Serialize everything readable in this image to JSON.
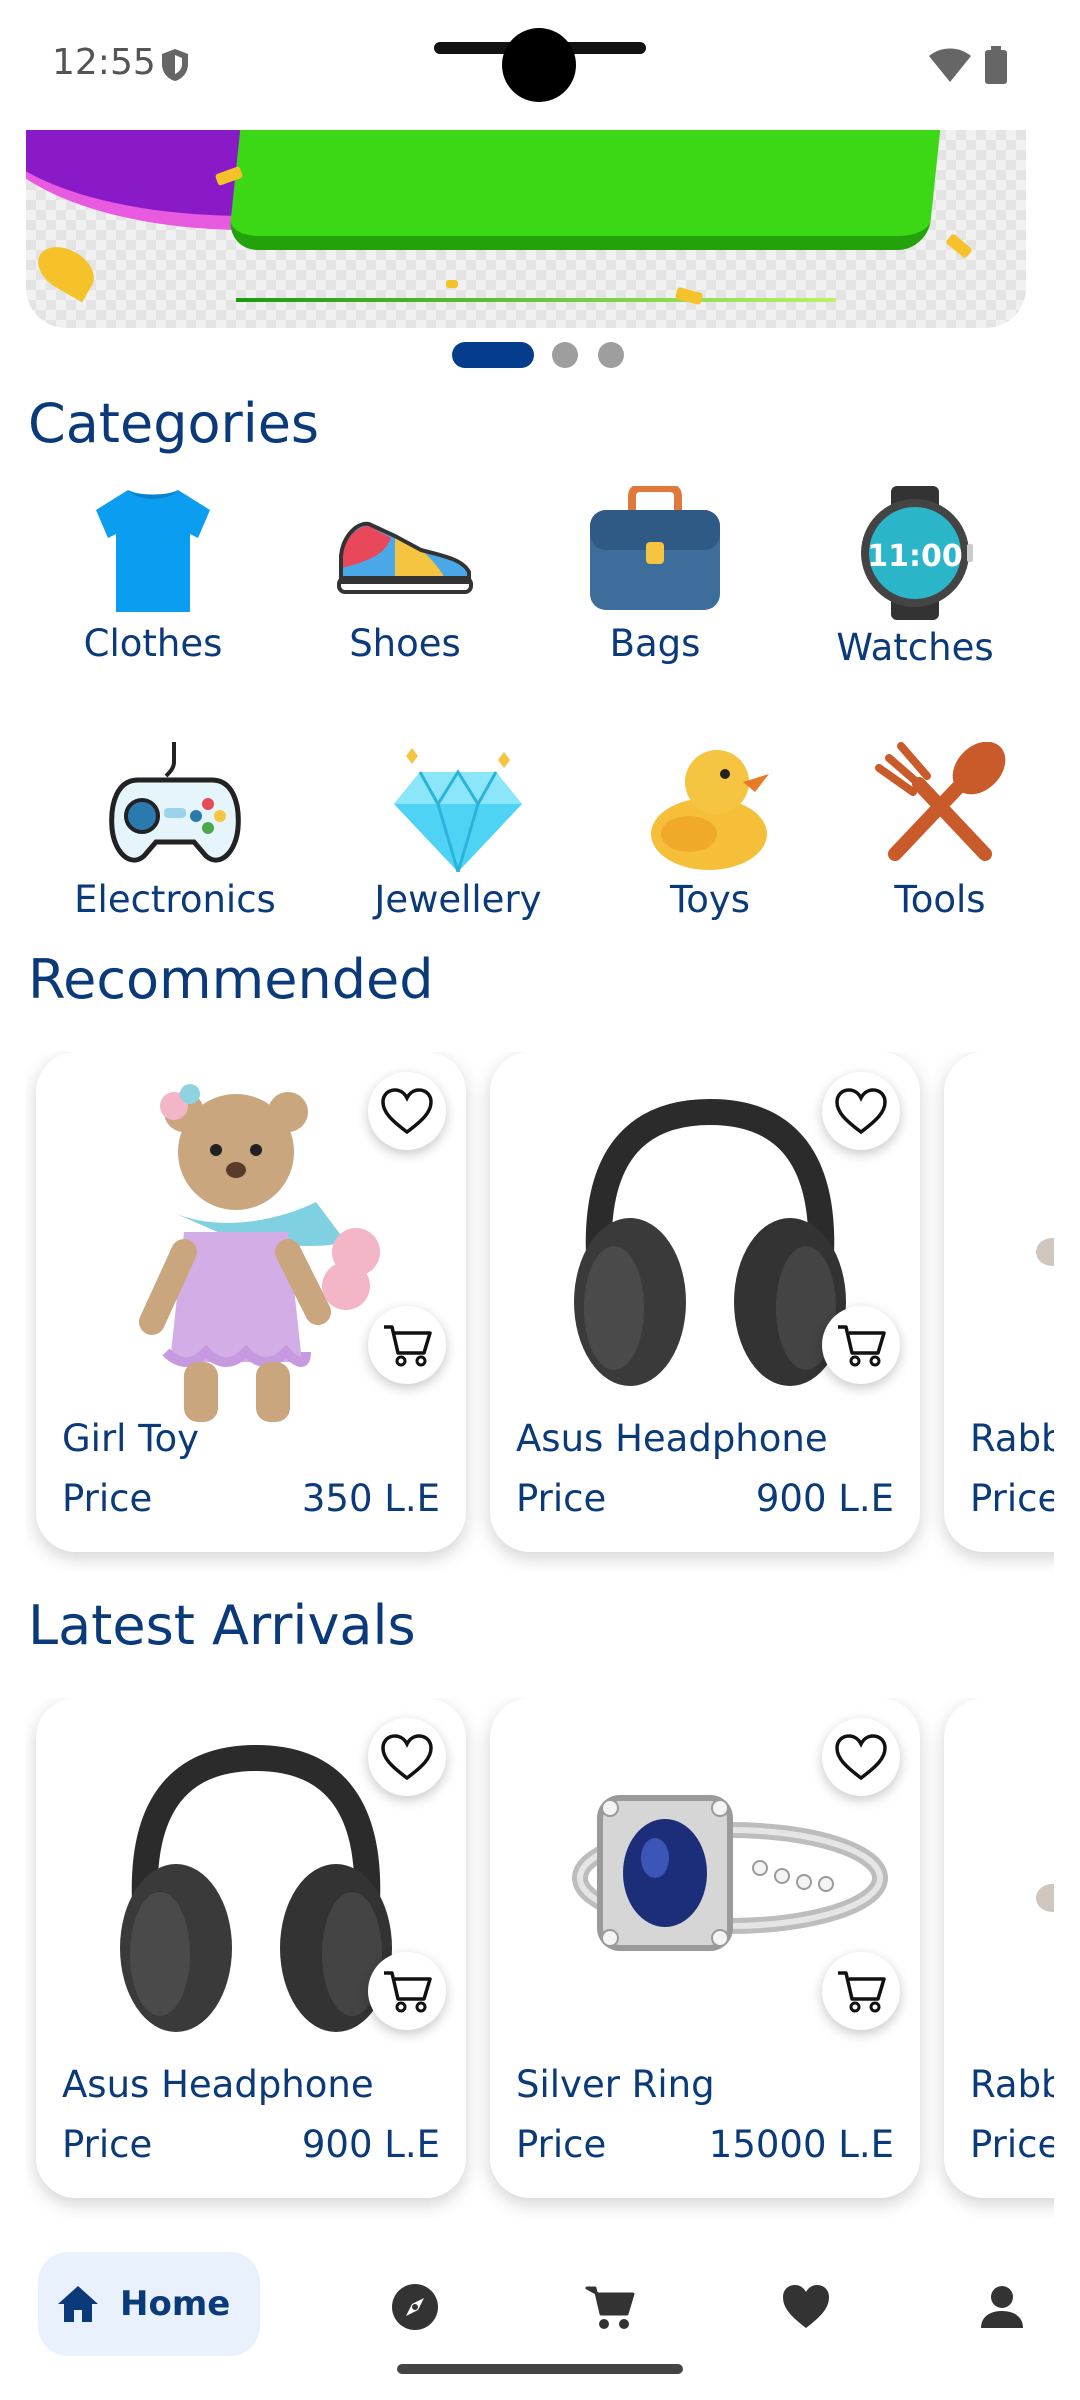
{
  "status_bar": {
    "time": "12:55",
    "icons": [
      "shield-icon",
      "wifi-icon",
      "battery-icon"
    ]
  },
  "banner": {
    "slides": 3,
    "active_slide": 1
  },
  "categories": {
    "title": "Categories",
    "items": [
      {
        "label": "Clothes",
        "icon": "tshirt-icon"
      },
      {
        "label": "Shoes",
        "icon": "sneaker-icon"
      },
      {
        "label": "Bags",
        "icon": "briefcase-icon"
      },
      {
        "label": "Watches",
        "icon": "smartwatch-icon"
      },
      {
        "label": "Electronics",
        "icon": "gamepad-icon"
      },
      {
        "label": "Jewellery",
        "icon": "diamond-icon"
      },
      {
        "label": "Toys",
        "icon": "rubber-duck-icon"
      },
      {
        "label": "Tools",
        "icon": "fork-spoon-icon"
      }
    ]
  },
  "recommended": {
    "title": "Recommended",
    "products": [
      {
        "name": "Girl Toy",
        "price_label": "Price",
        "price": "350 L.E",
        "image": "crochet-bear-toy"
      },
      {
        "name": "Asus Headphone",
        "price_label": "Price",
        "price": "900 L.E",
        "image": "headphones"
      },
      {
        "name": "Rabb",
        "price_label": "Price",
        "price": "",
        "image": "partial"
      }
    ]
  },
  "latest": {
    "title": "Latest Arrivals",
    "products": [
      {
        "name": "Asus Headphone",
        "price_label": "Price",
        "price": "900 L.E",
        "image": "headphones"
      },
      {
        "name": "Silver Ring",
        "price_label": "Price",
        "price": "15000 L.E",
        "image": "sapphire-ring"
      },
      {
        "name": "Rabb",
        "price_label": "Price",
        "price": "",
        "image": "partial"
      }
    ]
  },
  "bottom_nav": {
    "items": [
      {
        "label": "Home",
        "icon": "home-icon",
        "active": true
      },
      {
        "label": "",
        "icon": "compass-icon"
      },
      {
        "label": "",
        "icon": "cart-icon"
      },
      {
        "label": "",
        "icon": "heart-icon"
      },
      {
        "label": "",
        "icon": "person-icon"
      }
    ]
  },
  "colors": {
    "primary": "#0b3a7a",
    "active_dot": "#063c8c",
    "nav_active_bg": "#e9f1fc"
  }
}
